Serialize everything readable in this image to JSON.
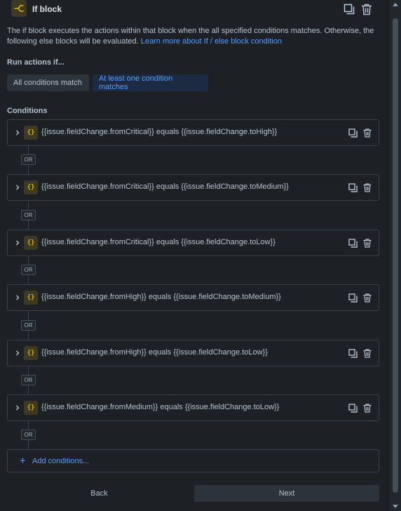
{
  "header": {
    "title": "If block",
    "icon": "branch-icon",
    "accent": "#e2b203"
  },
  "description": {
    "text": "The if block executes the actions within that block when the all specified conditions matches. Otherwise, the following else blocks will be evaluated. ",
    "link": "Learn more about If / else block condition"
  },
  "run_actions": {
    "label": "Run actions if...",
    "options": [
      "All conditions match",
      "At least one condition matches"
    ],
    "selected": "At least one condition matches"
  },
  "conditions": {
    "label": "Conditions",
    "separator": "OR",
    "items": [
      "{{issue.fieldChange.fromCritical}} equals {{issue.fieldChange.toHigh}}",
      "{{issue.fieldChange.fromCritical}} equals {{issue.fieldChange.toMedium}}",
      "{{issue.fieldChange.fromCritical}} equals {{issue.fieldChange.toLow}}",
      "{{issue.fieldChange.fromHigh}} equals {{issue.fieldChange.toMedium}}",
      "{{issue.fieldChange.fromHigh}} equals {{issue.fieldChange.toLow}}",
      "{{issue.fieldChange.fromMedium}} equals {{issue.fieldChange.toLow}}"
    ],
    "item_icon": "{}",
    "add_label": "Add conditions..."
  },
  "footer": {
    "back_label": "Back",
    "next_label": "Next"
  },
  "colors": {
    "background": "#1d2125",
    "link": "#579dff",
    "selected_bg": "#1c2b41"
  }
}
